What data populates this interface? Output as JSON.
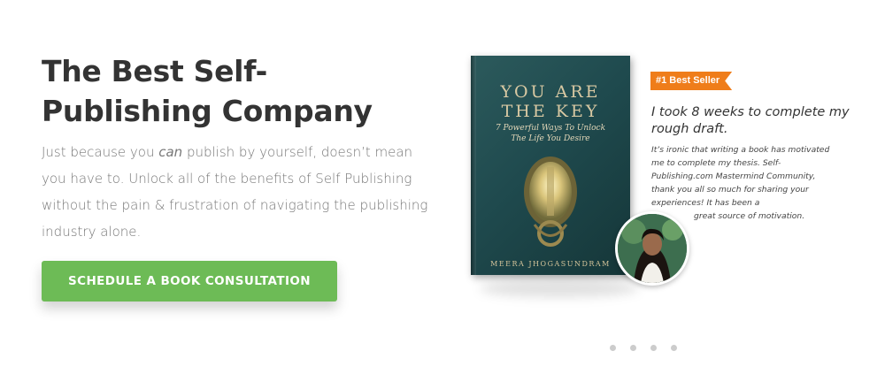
{
  "hero": {
    "title": "The Best Self-Publishing Company",
    "text_pre": "Just because you ",
    "text_em": "can",
    "text_post": " publish by yourself, doesn’t mean you have to. Unlock all of the benefits of Self Publishing without the pain & frustration of navigating the publishing industry alone.",
    "cta_label": "SCHEDULE A BOOK CONSULTATION"
  },
  "book": {
    "title": "YOU ARE\nTHE KEY",
    "subtitle": "7 Powerful Ways To Unlock\nThe Life You Desire",
    "author": "MEERA JHOGASUNDRAM"
  },
  "testimonial": {
    "badge": "#1 Best Seller",
    "headline": "I took 8 weeks to complete my rough draft.",
    "body": "It’s ironic that writing a book has motivated me to complete my thesis. Self-Publishing.com Mastermind Community, thank you all so much for sharing your experiences! It has been a",
    "body_last": "great source of motivation."
  },
  "carousel": {
    "dots": 4,
    "active_color": "#cccccc"
  },
  "colors": {
    "cta": "#6dbb56",
    "badge": "#ef7d1a",
    "book": "#1f4a4e"
  }
}
